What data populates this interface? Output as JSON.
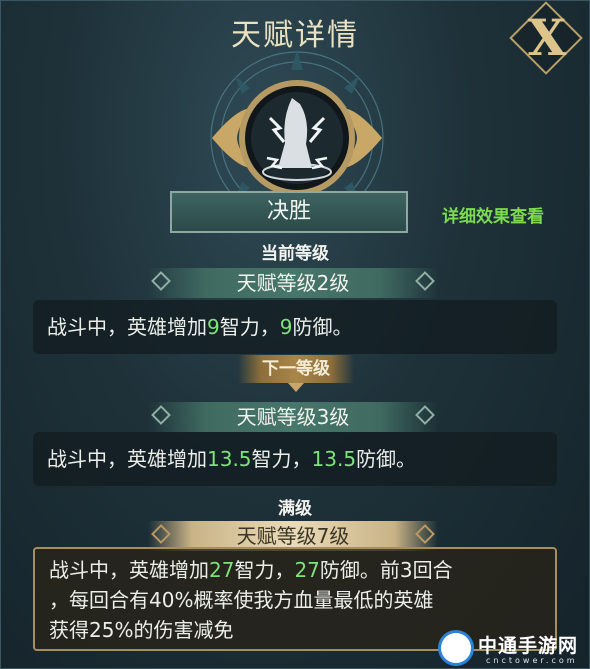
{
  "panel": {
    "title": "天赋详情",
    "close_label": "X"
  },
  "skill": {
    "name": "决胜",
    "detail_link": "详细效果查看",
    "icon": "lightning-fist-icon"
  },
  "current": {
    "section_label": "当前等级",
    "level_label": "天赋等级2级",
    "desc_prefix": "战斗中，英雄增加",
    "int_value": "9",
    "mid": "智力，",
    "def_value": "9",
    "suffix": "防御。"
  },
  "next": {
    "section_label": "下一等级",
    "level_label": "天赋等级3级",
    "desc_prefix": "战斗中，英雄增加",
    "int_value": "13.5",
    "mid": "智力，",
    "def_value": "13.5",
    "suffix": "防御。"
  },
  "max": {
    "section_label": "满级",
    "level_label": "天赋等级7级",
    "desc_prefix": "战斗中，英雄增加",
    "int_value": "27",
    "mid": "智力，",
    "def_value": "27",
    "suffix": "防御。前3回合",
    "line2": "，每回合有40%概率使我方血量最低的英雄",
    "line3": "获得25%的伤害减免"
  },
  "watermark": {
    "text": "中通手游网",
    "sub": "cnctower.com"
  },
  "colors": {
    "highlight_green": "#7de37a",
    "link_green": "#7bdc4e",
    "gold": "#c9b386"
  }
}
